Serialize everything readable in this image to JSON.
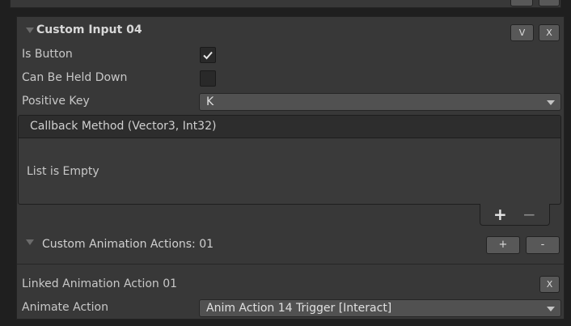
{
  "custom_input": {
    "title": "Custom Input 04",
    "v_button": "V",
    "x_button": "X",
    "is_button_label": "Is Button",
    "is_button_checked": true,
    "can_be_held_label": "Can Be Held Down",
    "can_be_held_checked": false,
    "positive_key_label": "Positive Key",
    "positive_key_value": "K"
  },
  "callback": {
    "header": "Callback Method (Vector3, Int32)",
    "empty_text": "List is Empty",
    "add_label": "+",
    "remove_label": "−"
  },
  "animation": {
    "header": "Custom Animation Actions: 01",
    "add_label": "+",
    "remove_label": "-"
  },
  "linked_action": {
    "title": "Linked Animation Action 01",
    "x_button": "X",
    "animate_label": "Animate Action",
    "animate_value": "Anim Action 14 Trigger [Interact]"
  }
}
